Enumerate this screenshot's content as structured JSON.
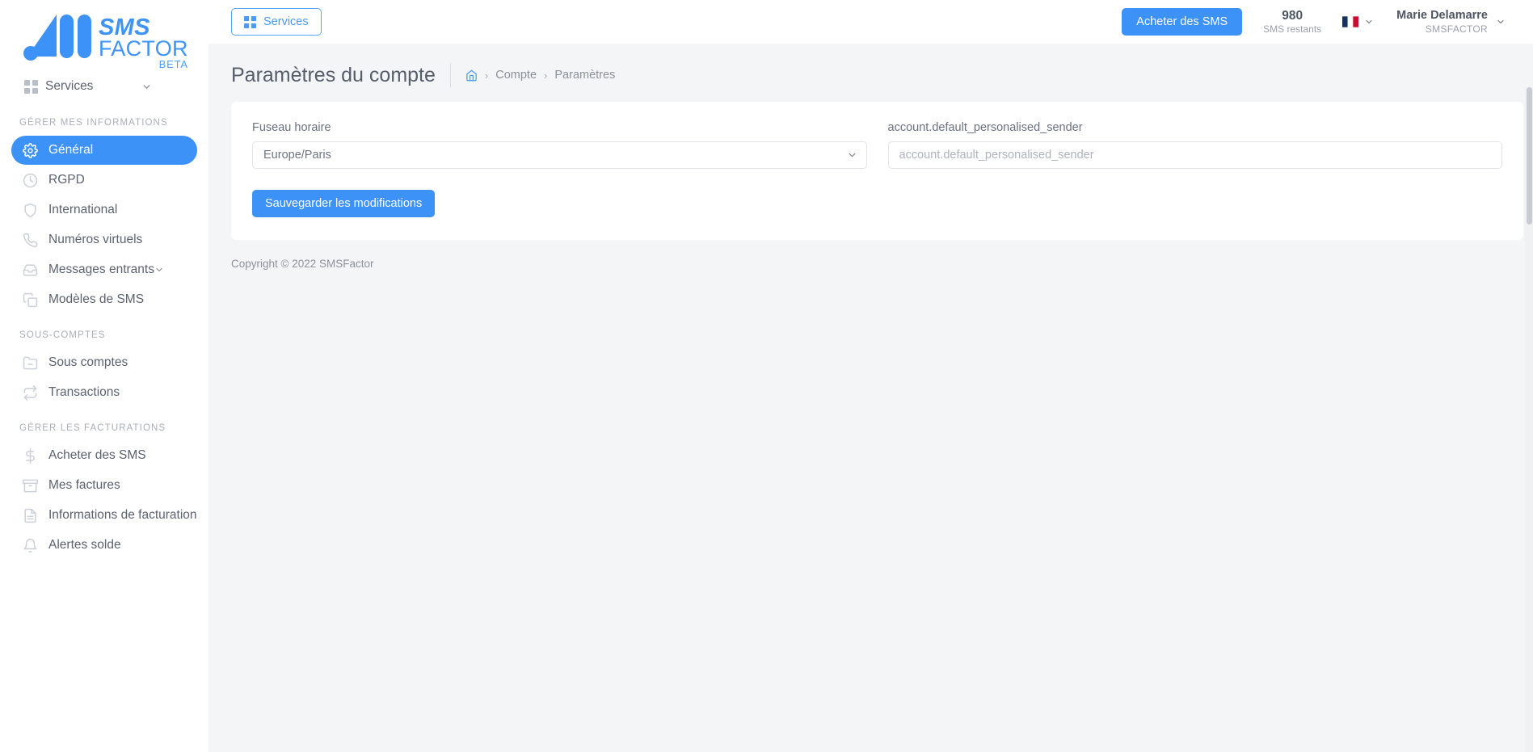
{
  "brand": {
    "logo_sms": "SMS",
    "logo_factor": "FACTOR",
    "logo_beta": "BETA",
    "accent_color": "#3c92f7"
  },
  "sidebar": {
    "top_nav": {
      "label": "Services",
      "icon": "grid-icon",
      "chevron": "chevron-down-icon"
    },
    "sections": [
      {
        "title": "GÉRER MES INFORMATIONS",
        "items": [
          {
            "label": "Général",
            "icon": "gear-icon",
            "active": true
          },
          {
            "label": "RGPD",
            "icon": "clock-icon",
            "active": false
          },
          {
            "label": "International",
            "icon": "shield-icon",
            "active": false
          },
          {
            "label": "Numéros virtuels",
            "icon": "phone-icon",
            "active": false
          },
          {
            "label": "Messages entrants",
            "icon": "inbox-icon",
            "active": false,
            "chevron": "chevron-down-icon"
          },
          {
            "label": "Modèles de SMS",
            "icon": "copy-icon",
            "active": false
          }
        ]
      },
      {
        "title": "SOUS-COMPTES",
        "items": [
          {
            "label": "Sous comptes",
            "icon": "folder-minus-icon",
            "active": false
          },
          {
            "label": "Transactions",
            "icon": "refresh-icon",
            "active": false
          }
        ]
      },
      {
        "title": "GÉRER LES FACTURATIONS",
        "items": [
          {
            "label": "Acheter des SMS",
            "icon": "dollar-icon",
            "active": false
          },
          {
            "label": "Mes factures",
            "icon": "archive-icon",
            "active": false
          },
          {
            "label": "Informations de facturation",
            "icon": "file-text-icon",
            "active": false
          },
          {
            "label": "Alertes solde",
            "icon": "bell-icon",
            "active": false
          }
        ]
      }
    ]
  },
  "topbar": {
    "services_button": "Services",
    "buy_button": "Acheter des SMS",
    "credits_value": "980",
    "credits_caption": "SMS restants",
    "language": "fr",
    "user_name": "Marie Delamarre",
    "user_org": "SMSFACTOR"
  },
  "page": {
    "title": "Paramètres du compte",
    "breadcrumb": [
      {
        "label": "Compte"
      },
      {
        "label": "Paramètres"
      }
    ]
  },
  "form": {
    "timezone": {
      "label": "Fuseau horaire",
      "value": "Europe/Paris",
      "options": [
        "Europe/Paris"
      ]
    },
    "sender": {
      "label": "account.default_personalised_sender",
      "value": "",
      "placeholder": "account.default_personalised_sender"
    },
    "save_button": "Sauvegarder les modifications"
  },
  "footer": {
    "copyright": "Copyright © 2022 SMSFactor"
  }
}
